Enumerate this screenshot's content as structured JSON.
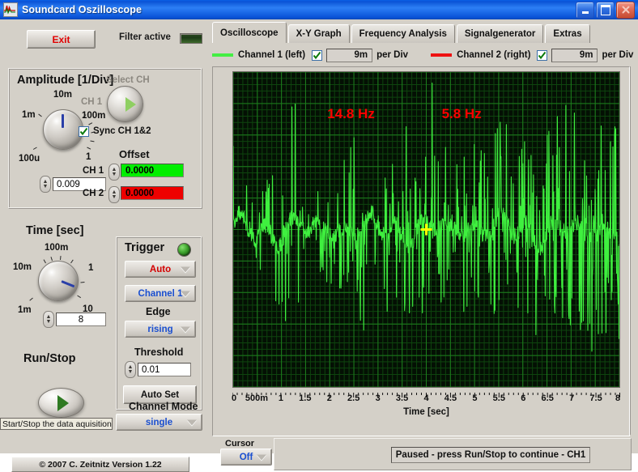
{
  "window": {
    "title": "Soundcard Oszilloscope",
    "icon": "waveform-icon",
    "buttons": {
      "minimize": "minimize-icon",
      "maximize": "maximize-icon",
      "close": "close-icon"
    }
  },
  "toolbar": {
    "exit_label": "Exit",
    "filter_label": "Filter active"
  },
  "amplitude": {
    "title": "Amplitude [1/Div]",
    "knob_ticks": [
      "100u",
      "1m",
      "10m",
      "100m",
      "1"
    ],
    "value": "0.009",
    "select_ch_label": "Select CH",
    "select_ch_value": "CH 1",
    "sync_label": "Sync CH 1&2",
    "sync_checked": true,
    "offset_title": "Offset",
    "offsets": [
      {
        "label": "CH 1",
        "value": "0.0000",
        "color": "#00ee00"
      },
      {
        "label": "CH 2",
        "value": "0.0000",
        "color": "#ee0000"
      }
    ]
  },
  "time": {
    "title": "Time [sec]",
    "knob_ticks": [
      "1m",
      "10m",
      "100m",
      "1",
      "10"
    ],
    "value": "8"
  },
  "trigger": {
    "title": "Trigger",
    "led_on": true,
    "mode": "Auto",
    "mode_color": "#d40000",
    "channel": "Channel 1",
    "edge_label": "Edge",
    "edge": "rising",
    "threshold_label": "Threshold",
    "threshold": "0.01",
    "auto_set_label": "Auto Set"
  },
  "run": {
    "title": "Run/Stop",
    "tooltip": "Start/Stop the data aquisition"
  },
  "channel_mode": {
    "label": "Channel Mode",
    "value": "single"
  },
  "footer": {
    "copyright": "© 2007   C. Zeitnitz Version 1.22"
  },
  "tabs": [
    {
      "label": "Oscilloscope",
      "active": true
    },
    {
      "label": "X-Y Graph",
      "active": false
    },
    {
      "label": "Frequency Analysis",
      "active": false
    },
    {
      "label": "Signalgenerator",
      "active": false
    },
    {
      "label": "Extras",
      "active": false
    }
  ],
  "channels": [
    {
      "name": "Channel 1 (left)",
      "color": "#44ee44",
      "enabled": true,
      "per_div": "9m",
      "per_div_label": "per Div"
    },
    {
      "name": "Channel 2 (right)",
      "color": "#ee1111",
      "enabled": true,
      "per_div": "9m",
      "per_div_label": "per Div"
    }
  ],
  "cursor": {
    "label": "Cursor",
    "value": "Off"
  },
  "status": {
    "text": "Paused - press Run/Stop to continue - CH1"
  },
  "chart_data": {
    "type": "line",
    "title": "",
    "xlabel": "Time [sec]",
    "ylabel": "",
    "xlim": [
      0,
      8
    ],
    "ylim": [
      -1,
      1
    ],
    "xticks": [
      0,
      0.5,
      1,
      1.5,
      2,
      2.5,
      3,
      3.5,
      4,
      4.5,
      5,
      5.5,
      6,
      6.5,
      7,
      7.5,
      8
    ],
    "xticklabels": [
      "0",
      "500m",
      "1",
      "1.5",
      "2",
      "2.5",
      "3",
      "3.5",
      "4",
      "4.5",
      "5",
      "5.5",
      "6",
      "6.5",
      "7",
      "7.5",
      "8"
    ],
    "grid": true,
    "grid_major_divisions_x": 16,
    "grid_major_divisions_y": 10,
    "background": "#041004",
    "grid_color": "#1d7d1d",
    "annotations": [
      {
        "text": "14.8 Hz",
        "x": 1.95,
        "y": 0.72,
        "color": "#ff0000"
      },
      {
        "text": "5.8 Hz",
        "x": 4.32,
        "y": 0.72,
        "color": "#ff0000"
      }
    ],
    "cursor_marker": {
      "x": 4.0,
      "y": 0.0,
      "color": "#ffff00",
      "shape": "cross"
    },
    "series": [
      {
        "name": "Channel 1 (left)",
        "color": "#3ff03f",
        "per_div": "9m",
        "description": "Dense noisy audio waveform, amplitude spikes roughly +/-0.75 full scale, spike density increasing toward the right",
        "values": []
      },
      {
        "name": "Channel 2 (right)",
        "color": "#ee1111",
        "per_div": "9m",
        "description": "Hidden beneath channel 1 trace",
        "values": []
      }
    ]
  }
}
